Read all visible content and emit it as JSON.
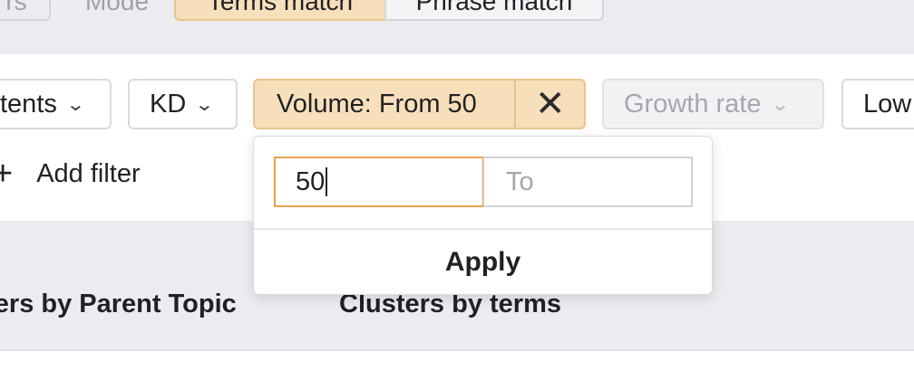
{
  "mode_bar": {
    "left_cut_label": "rs",
    "mode_label": "Mode",
    "terms_match_label": "Terms match",
    "phrase_match_label": "Phrase match"
  },
  "filters": {
    "intents_label": "tents",
    "kd_label": "KD",
    "volume_label": "Volume: From 50",
    "volume_clear_glyph": "✕",
    "growth_rate_label": "Growth rate",
    "low_label": "Low",
    "chevron_glyph": "⌄"
  },
  "add_filter": {
    "icon_glyph": "+",
    "label": "Add filter"
  },
  "volume_popover": {
    "from_value": "50",
    "to_placeholder": "To",
    "apply_label": "Apply"
  },
  "tabs": {
    "parent_topic_label": "sters by Parent Topic",
    "terms_label": "Clusters by terms"
  },
  "colors": {
    "active_chip_bg": "#f8dfbb",
    "active_chip_border": "#e8c48f",
    "input_focus_border": "#e8a24c",
    "page_bg": "#ebecf0"
  },
  "icons": {
    "chevron": "chevron-down-icon",
    "clear": "close-icon",
    "add": "plus-icon"
  }
}
